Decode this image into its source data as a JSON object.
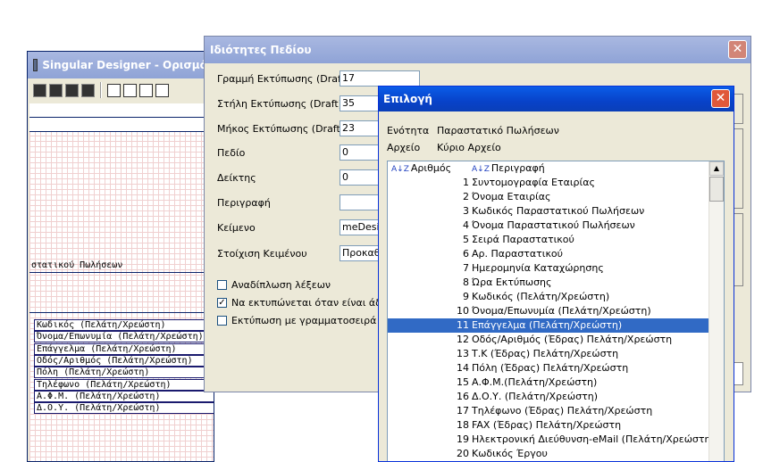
{
  "designer": {
    "title": "Singular Designer - Ορισμός",
    "header_field": "στατικού Πωλήσεων",
    "fields": [
      "Κωδικός (Πελάτη/Χρεώστη)",
      "Όνομα/Επωνυμία (Πελάτη/Χρεώστη)",
      "Επάγγελμα (Πελάτη/Χρεώστη)",
      "Οδός/Αριθμός (Πελάτη/Χρεώστη)",
      "Πόλη (Πελάτη/Χρεώστη)",
      "Τηλέφωνο (Πελάτη/Χρεώστη)",
      "Α.Φ.Μ. (Πελάτη/Χρεώστη)",
      "Δ.Ο.Υ. (Πελάτη/Χρεώστη)"
    ]
  },
  "props": {
    "title": "Ιδιότητες Πεδίου",
    "close": "✕",
    "rows": [
      {
        "label": "Γραμμή Εκτύπωσης (Draft)",
        "value": "17"
      },
      {
        "label": "Στήλη Εκτύπωσης (Draft)",
        "value": "35"
      },
      {
        "label": "Μήκος Εκτύπωσης (Draft)",
        "value": "23"
      },
      {
        "label": "Πεδίο",
        "value": "0"
      },
      {
        "label": "Δείκτης",
        "value": "0"
      },
      {
        "label": "Περιγραφή",
        "value": ""
      },
      {
        "label": "Κείμενο",
        "value": "meDesig"
      },
      {
        "label": "Στοίχιση Κειμένου",
        "value": "Προκαθ"
      }
    ],
    "checks": [
      {
        "label": "Αναδίπλωση λέξεων",
        "checked": false,
        "mark": ""
      },
      {
        "label": "Να εκτυπώνεται όταν είναι άδει",
        "checked": true,
        "mark": "✓"
      },
      {
        "label": "Εκτύπωση με γραμματοσειρά ΟΣ",
        "checked": false,
        "mark": ""
      }
    ]
  },
  "choice": {
    "title": "Επιλογή",
    "close": "✕",
    "section_label": "Ενότητα",
    "section_value": "Παραστατικό Πωλήσεων",
    "file_label": "Αρχείο",
    "file_value": "Κύριο Αρχείο",
    "col_number": "Αριθμός",
    "col_desc": "Περιγραφή",
    "sort_icon": "A↓Z",
    "selected_index": 10,
    "items": [
      {
        "num": "1",
        "desc": "Συντομογραφία Εταιρίας"
      },
      {
        "num": "2",
        "desc": "Όνομα Εταιρίας"
      },
      {
        "num": "3",
        "desc": "Κωδικός Παραστατικού Πωλήσεων"
      },
      {
        "num": "4",
        "desc": "Όνομα Παραστατικού Πωλήσεων"
      },
      {
        "num": "5",
        "desc": "Σειρά Παραστατικού"
      },
      {
        "num": "6",
        "desc": "Αρ. Παραστατικού"
      },
      {
        "num": "7",
        "desc": "Ημερομηνία Καταχώρησης"
      },
      {
        "num": "8",
        "desc": "Ώρα Εκτύπωσης"
      },
      {
        "num": "9",
        "desc": "Κωδικός (Πελάτη/Χρεώστη)"
      },
      {
        "num": "10",
        "desc": "Όνομα/Επωνυμία (Πελάτη/Χρεώστη)"
      },
      {
        "num": "11",
        "desc": "Επάγγελμα (Πελάτη/Χρεώστη)"
      },
      {
        "num": "12",
        "desc": "Οδός/Αριθμός (Έδρας) Πελάτη/Χρεώστη"
      },
      {
        "num": "13",
        "desc": "Τ.Κ (Έδρας) Πελάτη/Χρεώστη"
      },
      {
        "num": "14",
        "desc": "Πόλη (Έδρας) Πελάτη/Χρεώστη"
      },
      {
        "num": "15",
        "desc": "Α.Φ.Μ.(Πελάτη/Χρεώστη)"
      },
      {
        "num": "16",
        "desc": "Δ.Ο.Υ. (Πελάτη/Χρεώστη)"
      },
      {
        "num": "17",
        "desc": "Τηλέφωνο (Έδρας) Πελάτη/Χρεώστη"
      },
      {
        "num": "18",
        "desc": "FAX (Έδρας) Πελάτη/Χρεώστη"
      },
      {
        "num": "19",
        "desc": "Ηλεκτρονική Διεύθυνση-eMail (Πελάτη/Χρεώστη)"
      },
      {
        "num": "20",
        "desc": "Κωδικός Έργου"
      }
    ]
  }
}
